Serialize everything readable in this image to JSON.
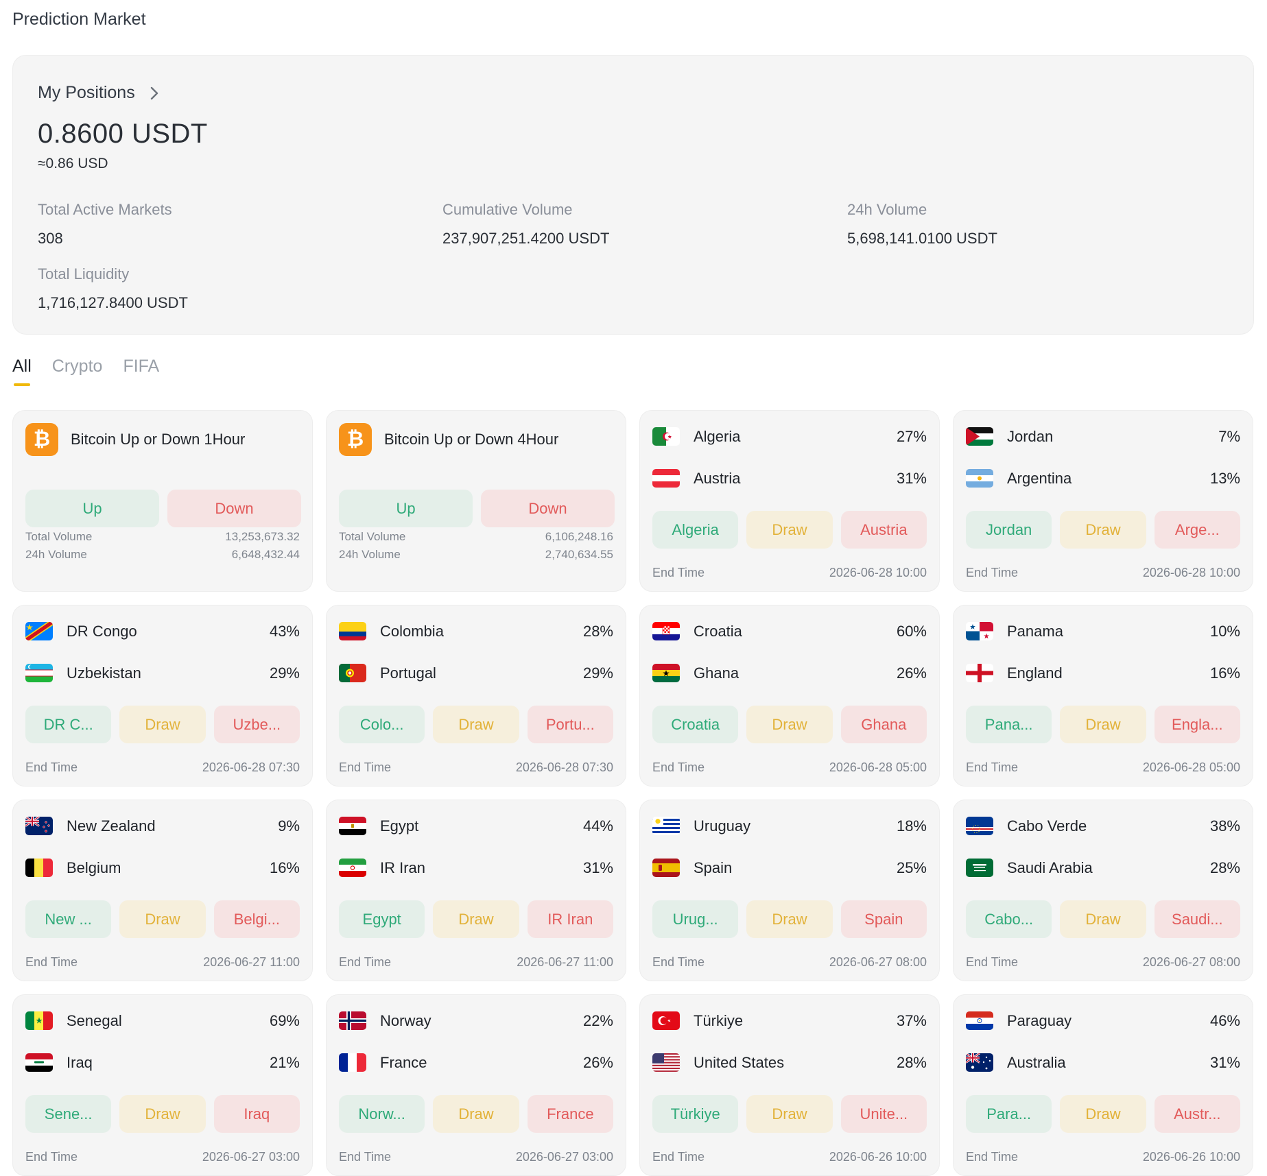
{
  "page_title": "Prediction Market",
  "positions": {
    "link_label": "My Positions",
    "balance": "0.8600 USDT",
    "approx": "≈0.86 USD"
  },
  "stats": {
    "active_markets_label": "Total Active Markets",
    "active_markets_value": "308",
    "cumulative_volume_label": "Cumulative Volume",
    "cumulative_volume_value": "237,907,251.4200 USDT",
    "volume_24h_label": "24h Volume",
    "volume_24h_value": "5,698,141.0100 USDT",
    "liquidity_label": "Total Liquidity",
    "liquidity_value": "1,716,127.8400 USDT"
  },
  "tabs": [
    "All",
    "Crypto",
    "FIFA"
  ],
  "colors": {
    "accent": "#f0b90b",
    "up": "#2faa79",
    "draw": "#e2b23a",
    "down": "#e25a5a",
    "bitcoin": "#f7931a"
  },
  "crypto_markets": [
    {
      "title": "Bitcoin Up or Down 1Hour",
      "up": "Up",
      "down": "Down",
      "total_volume_label": "Total Volume",
      "total_volume": "13,253,673.32",
      "volume_24h_label": "24h Volume",
      "volume_24h": "6,648,432.44"
    },
    {
      "title": "Bitcoin Up or Down 4Hour",
      "up": "Up",
      "down": "Down",
      "total_volume_label": "Total Volume",
      "total_volume": "6,106,248.16",
      "volume_24h_label": "24h Volume",
      "volume_24h": "2,740,634.55"
    }
  ],
  "matches": [
    {
      "home": "Algeria",
      "home_flag": "algeria-flag",
      "home_pct": "27%",
      "away": "Austria",
      "away_flag": "austria-flag",
      "away_pct": "31%",
      "home_btn": "Algeria",
      "draw_btn": "Draw",
      "away_btn": "Austria",
      "end_label": "End Time",
      "end_time": "2026-06-28 10:00"
    },
    {
      "home": "Jordan",
      "home_flag": "jordan-flag",
      "home_pct": "7%",
      "away": "Argentina",
      "away_flag": "argentina-flag",
      "away_pct": "13%",
      "home_btn": "Jordan",
      "draw_btn": "Draw",
      "away_btn": "Arge...",
      "end_label": "End Time",
      "end_time": "2026-06-28 10:00"
    },
    {
      "home": "DR Congo",
      "home_flag": "dr-congo-flag",
      "home_pct": "43%",
      "away": "Uzbekistan",
      "away_flag": "uzbekistan-flag",
      "away_pct": "29%",
      "home_btn": "DR C...",
      "draw_btn": "Draw",
      "away_btn": "Uzbe...",
      "end_label": "End Time",
      "end_time": "2026-06-28 07:30"
    },
    {
      "home": "Colombia",
      "home_flag": "colombia-flag",
      "home_pct": "28%",
      "away": "Portugal",
      "away_flag": "portugal-flag",
      "away_pct": "29%",
      "home_btn": "Colo...",
      "draw_btn": "Draw",
      "away_btn": "Portu...",
      "end_label": "End Time",
      "end_time": "2026-06-28 07:30"
    },
    {
      "home": "Croatia",
      "home_flag": "croatia-flag",
      "home_pct": "60%",
      "away": "Ghana",
      "away_flag": "ghana-flag",
      "away_pct": "26%",
      "home_btn": "Croatia",
      "draw_btn": "Draw",
      "away_btn": "Ghana",
      "end_label": "End Time",
      "end_time": "2026-06-28 05:00"
    },
    {
      "home": "Panama",
      "home_flag": "panama-flag",
      "home_pct": "10%",
      "away": "England",
      "away_flag": "england-flag",
      "away_pct": "16%",
      "home_btn": "Pana...",
      "draw_btn": "Draw",
      "away_btn": "Engla...",
      "end_label": "End Time",
      "end_time": "2026-06-28 05:00"
    },
    {
      "home": "New Zealand",
      "home_flag": "new-zealand-flag",
      "home_pct": "9%",
      "away": "Belgium",
      "away_flag": "belgium-flag",
      "away_pct": "16%",
      "home_btn": "New ...",
      "draw_btn": "Draw",
      "away_btn": "Belgi...",
      "end_label": "End Time",
      "end_time": "2026-06-27 11:00"
    },
    {
      "home": "Egypt",
      "home_flag": "egypt-flag",
      "home_pct": "44%",
      "away": "IR Iran",
      "away_flag": "iran-flag",
      "away_pct": "31%",
      "home_btn": "Egypt",
      "draw_btn": "Draw",
      "away_btn": "IR Iran",
      "end_label": "End Time",
      "end_time": "2026-06-27 11:00"
    },
    {
      "home": "Uruguay",
      "home_flag": "uruguay-flag",
      "home_pct": "18%",
      "away": "Spain",
      "away_flag": "spain-flag",
      "away_pct": "25%",
      "home_btn": "Urug...",
      "draw_btn": "Draw",
      "away_btn": "Spain",
      "end_label": "End Time",
      "end_time": "2026-06-27 08:00"
    },
    {
      "home": "Cabo Verde",
      "home_flag": "cabo-verde-flag",
      "home_pct": "38%",
      "away": "Saudi Arabia",
      "away_flag": "saudi-arabia-flag",
      "away_pct": "28%",
      "home_btn": "Cabo...",
      "draw_btn": "Draw",
      "away_btn": "Saudi...",
      "end_label": "End Time",
      "end_time": "2026-06-27 08:00"
    },
    {
      "home": "Senegal",
      "home_flag": "senegal-flag",
      "home_pct": "69%",
      "away": "Iraq",
      "away_flag": "iraq-flag",
      "away_pct": "21%",
      "home_btn": "Sene...",
      "draw_btn": "Draw",
      "away_btn": "Iraq",
      "end_label": "End Time",
      "end_time": "2026-06-27 03:00"
    },
    {
      "home": "Norway",
      "home_flag": "norway-flag",
      "home_pct": "22%",
      "away": "France",
      "away_flag": "france-flag",
      "away_pct": "26%",
      "home_btn": "Norw...",
      "draw_btn": "Draw",
      "away_btn": "France",
      "end_label": "End Time",
      "end_time": "2026-06-27 03:00"
    },
    {
      "home": "Türkiye",
      "home_flag": "turkiye-flag",
      "home_pct": "37%",
      "away": "United States",
      "away_flag": "united-states-flag",
      "away_pct": "28%",
      "home_btn": "Türkiye",
      "draw_btn": "Draw",
      "away_btn": "Unite...",
      "end_label": "End Time",
      "end_time": "2026-06-26 10:00"
    },
    {
      "home": "Paraguay",
      "home_flag": "paraguay-flag",
      "home_pct": "46%",
      "away": "Australia",
      "away_flag": "australia-flag",
      "away_pct": "31%",
      "home_btn": "Para...",
      "draw_btn": "Draw",
      "away_btn": "Austr...",
      "end_label": "End Time",
      "end_time": "2026-06-26 10:00"
    }
  ]
}
